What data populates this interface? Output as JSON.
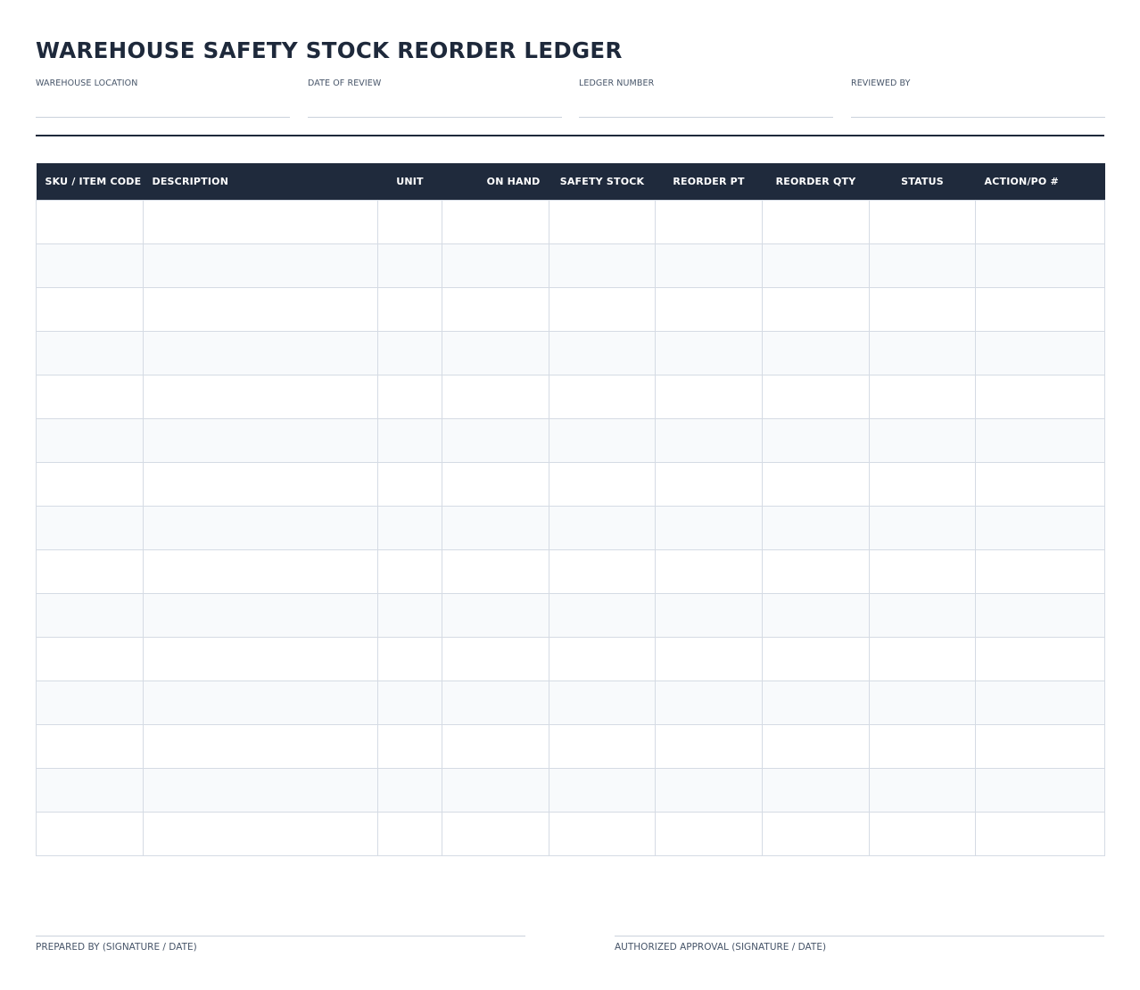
{
  "title": "WAREHOUSE SAFETY STOCK REORDER LEDGER",
  "header_fields": [
    {
      "label": "WAREHOUSE LOCATION",
      "value": ""
    },
    {
      "label": "DATE OF REVIEW",
      "value": ""
    },
    {
      "label": "LEDGER NUMBER",
      "value": ""
    },
    {
      "label": "REVIEWED BY",
      "value": ""
    }
  ],
  "table": {
    "columns": [
      "SKU / ITEM CODE",
      "DESCRIPTION",
      "UNIT",
      "ON HAND",
      "SAFETY STOCK",
      "REORDER PT",
      "REORDER QTY",
      "STATUS",
      "ACTION/PO #"
    ],
    "rows": [
      [
        "",
        "",
        "",
        "",
        "",
        "",
        "",
        "",
        ""
      ],
      [
        "",
        "",
        "",
        "",
        "",
        "",
        "",
        "",
        ""
      ],
      [
        "",
        "",
        "",
        "",
        "",
        "",
        "",
        "",
        ""
      ],
      [
        "",
        "",
        "",
        "",
        "",
        "",
        "",
        "",
        ""
      ],
      [
        "",
        "",
        "",
        "",
        "",
        "",
        "",
        "",
        ""
      ],
      [
        "",
        "",
        "",
        "",
        "",
        "",
        "",
        "",
        ""
      ],
      [
        "",
        "",
        "",
        "",
        "",
        "",
        "",
        "",
        ""
      ],
      [
        "",
        "",
        "",
        "",
        "",
        "",
        "",
        "",
        ""
      ],
      [
        "",
        "",
        "",
        "",
        "",
        "",
        "",
        "",
        ""
      ],
      [
        "",
        "",
        "",
        "",
        "",
        "",
        "",
        "",
        ""
      ],
      [
        "",
        "",
        "",
        "",
        "",
        "",
        "",
        "",
        ""
      ],
      [
        "",
        "",
        "",
        "",
        "",
        "",
        "",
        "",
        ""
      ],
      [
        "",
        "",
        "",
        "",
        "",
        "",
        "",
        "",
        ""
      ],
      [
        "",
        "",
        "",
        "",
        "",
        "",
        "",
        "",
        ""
      ],
      [
        "",
        "",
        "",
        "",
        "",
        "",
        "",
        "",
        ""
      ]
    ]
  },
  "signatures": {
    "prepared_by": "PREPARED BY (SIGNATURE / DATE)",
    "authorized_approval": "AUTHORIZED APPROVAL (SIGNATURE / DATE)"
  },
  "colors": {
    "header_background": "#1f2a3c",
    "title_text": "#1e293b",
    "grid_line": "#d5dbe4",
    "alt_row": "#f8fafc"
  }
}
